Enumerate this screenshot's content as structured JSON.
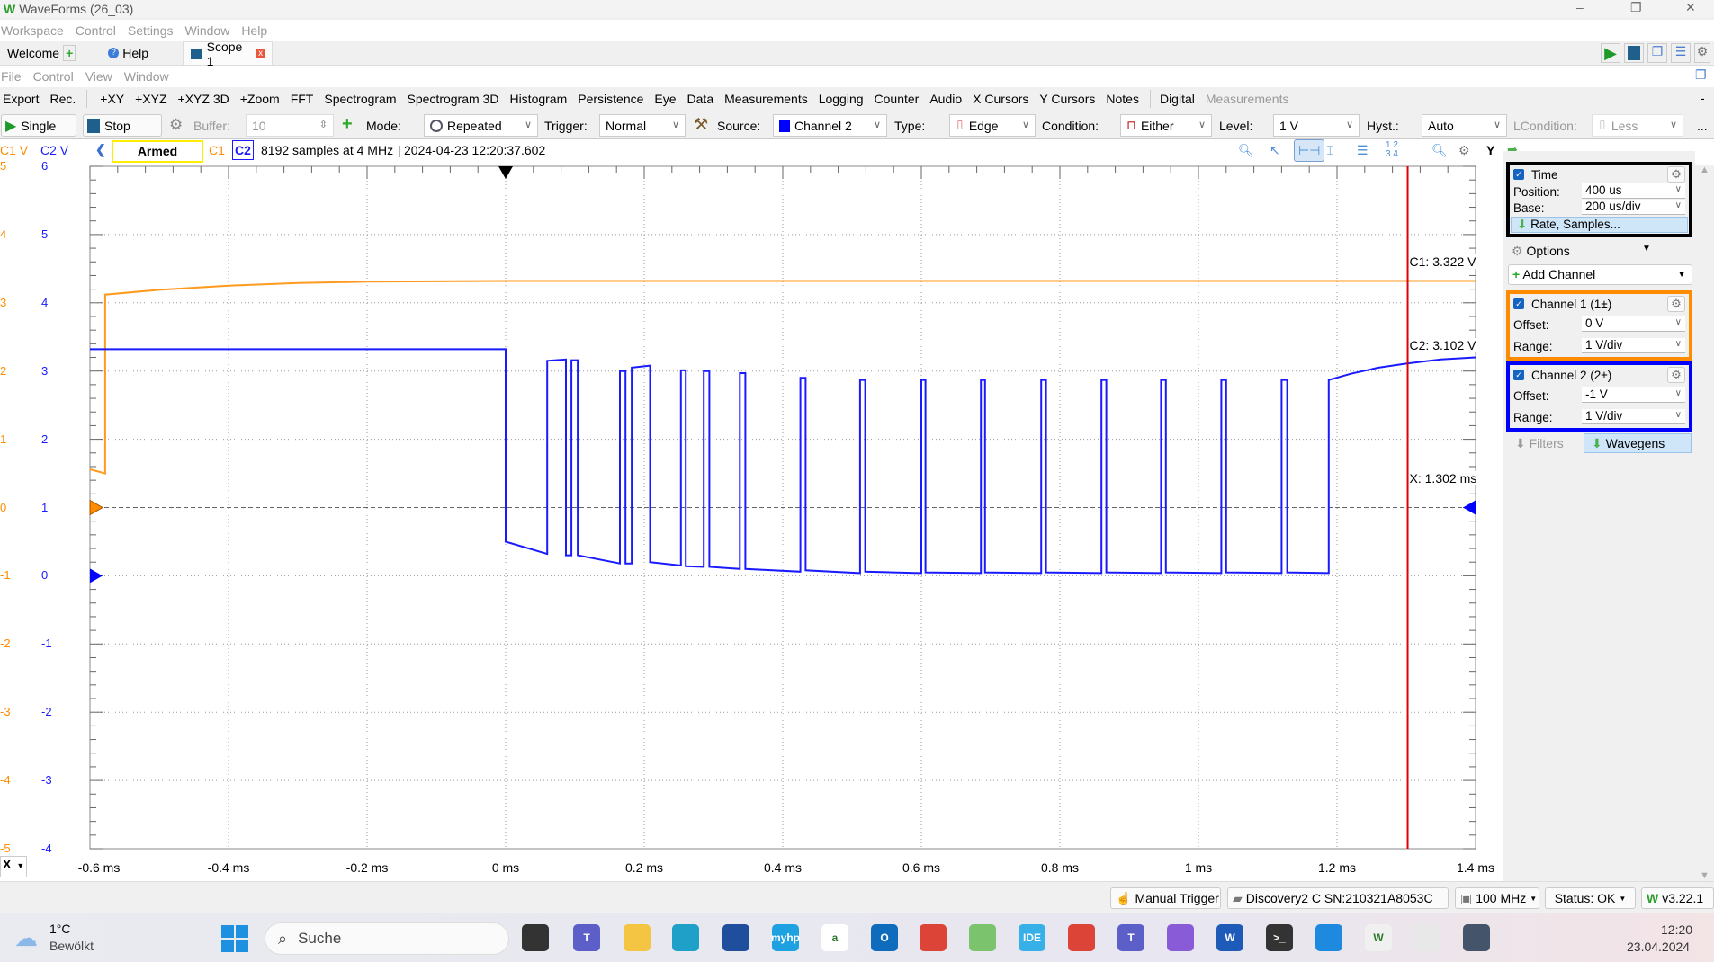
{
  "window": {
    "title": "WaveForms (26_03)",
    "controls": [
      "–",
      "❐",
      "✕"
    ]
  },
  "menu_main": [
    "Workspace",
    "Control",
    "Settings",
    "Window",
    "Help"
  ],
  "tabs": [
    {
      "label": "Welcome",
      "icon": "plus-icon"
    },
    {
      "label": "Help",
      "icon": "help-icon"
    },
    {
      "label": "Scope 1",
      "icon": "scope-icon",
      "active": true,
      "close_icon": "close-icon"
    }
  ],
  "menu_scope": [
    "File",
    "Control",
    "View",
    "Window"
  ],
  "toolbar1": {
    "left": [
      "Export",
      "Rec."
    ],
    "items": [
      "+XY",
      "+XYZ",
      "+XYZ 3D",
      "+Zoom",
      "FFT",
      "Spectrogram",
      "Spectrogram 3D",
      "Histogram",
      "Persistence",
      "Eye",
      "Data",
      "Measurements",
      "Logging",
      "Counter",
      "Audio",
      "X Cursors",
      "Y Cursors",
      "Notes"
    ],
    "digital": "Digital",
    "measurements_disabled": "Measurements",
    "collapse": "-"
  },
  "toolbar2": {
    "single": "Single",
    "stop": "Stop",
    "buffer_label": "Buffer:",
    "buffer_value": "10",
    "mode_label": "Mode:",
    "mode_value": "Repeated",
    "trigger_label": "Trigger:",
    "trigger_value": "Normal",
    "source_label": "Source:",
    "source_value": "Channel 2",
    "type_label": "Type:",
    "type_value": "Edge",
    "condition_label": "Condition:",
    "condition_value": "Either",
    "level_label": "Level:",
    "level_value": "1 V",
    "hyst_label": "Hyst.:",
    "hyst_value": "Auto",
    "lcondition_label": "LCondition:",
    "lcondition_value": "Less",
    "more": "..."
  },
  "info": {
    "c1_unit": "C1 V",
    "c2_unit": "C2 V",
    "state": "Armed",
    "c1": "C1",
    "c2": "C2",
    "acquisition": "8192 samples at 4 MHz",
    "timestamp": "2024-04-23 12:20:37.602",
    "y_label": "Y"
  },
  "colors": {
    "c1": "#ff9a1f",
    "c2": "#1a1aff",
    "cursor": "#e00000",
    "armed_border": "#ffee00"
  },
  "chart_data": {
    "type": "line",
    "x_unit": "ms",
    "xlim": [
      -0.6,
      1.4
    ],
    "x_ticks": [
      "-0.6 ms",
      "-0.4 ms",
      "-0.2 ms",
      "0 ms",
      "0.2 ms",
      "0.4 ms",
      "0.6 ms",
      "0.8 ms",
      "1 ms",
      "1.2 ms",
      "1.4 ms"
    ],
    "c1_ticks": [
      "5",
      "4",
      "3",
      "2",
      "1",
      "0",
      "-1",
      "-2",
      "-3",
      "-4",
      "-5"
    ],
    "c2_ticks": [
      "6",
      "5",
      "4",
      "3",
      "2",
      "1",
      "0",
      "-1",
      "-2",
      "-3",
      "-4"
    ],
    "c1_ylim": [
      -5,
      5
    ],
    "c2_ylim": [
      -4,
      6
    ],
    "grid": true,
    "series": [
      {
        "name": "C1",
        "axis": "c1",
        "points": [
          [
            -0.6,
            0.56
          ],
          [
            -0.578,
            0.5
          ],
          [
            -0.578,
            3.12
          ],
          [
            -0.5,
            3.19
          ],
          [
            -0.4,
            3.25
          ],
          [
            -0.3,
            3.29
          ],
          [
            -0.2,
            3.31
          ],
          [
            0,
            3.32
          ],
          [
            1.4,
            3.32
          ]
        ]
      },
      {
        "name": "C2",
        "axis": "c2",
        "points": [
          [
            -0.6,
            3.32
          ],
          [
            0,
            3.32
          ],
          [
            0,
            0.5
          ],
          [
            0.06,
            0.32
          ],
          [
            0.06,
            3.15
          ],
          [
            0.087,
            3.17
          ],
          [
            0.087,
            0.3
          ],
          [
            0.095,
            0.3
          ],
          [
            0.095,
            3.16
          ],
          [
            0.104,
            3.16
          ],
          [
            0.104,
            0.3
          ],
          [
            0.165,
            0.18
          ],
          [
            0.165,
            3.0
          ],
          [
            0.173,
            3.0
          ],
          [
            0.173,
            0.18
          ],
          [
            0.182,
            0.18
          ],
          [
            0.182,
            3.05
          ],
          [
            0.2085,
            3.08
          ],
          [
            0.2085,
            0.2
          ],
          [
            0.253,
            0.15
          ],
          [
            0.253,
            3.01
          ],
          [
            0.26,
            3.01
          ],
          [
            0.26,
            0.14
          ],
          [
            0.286,
            0.13
          ],
          [
            0.286,
            3.0
          ],
          [
            0.294,
            3.0
          ],
          [
            0.294,
            0.13
          ],
          [
            0.338,
            0.1
          ],
          [
            0.338,
            2.97
          ],
          [
            0.346,
            2.97
          ],
          [
            0.346,
            0.1
          ],
          [
            0.4255,
            0.06
          ],
          [
            0.4255,
            2.9
          ],
          [
            0.433,
            2.9
          ],
          [
            0.433,
            0.08
          ],
          [
            0.5115,
            0.04
          ],
          [
            0.5115,
            2.87
          ],
          [
            0.519,
            2.87
          ],
          [
            0.519,
            0.06
          ],
          [
            0.6,
            0.04
          ],
          [
            0.6,
            2.87
          ],
          [
            0.606,
            2.87
          ],
          [
            0.606,
            0.05
          ],
          [
            0.686,
            0.04
          ],
          [
            0.686,
            2.87
          ],
          [
            0.692,
            2.87
          ],
          [
            0.692,
            0.05
          ],
          [
            0.773,
            0.04
          ],
          [
            0.773,
            2.87
          ],
          [
            0.78,
            2.87
          ],
          [
            0.78,
            0.05
          ],
          [
            0.86,
            0.04
          ],
          [
            0.86,
            2.87
          ],
          [
            0.867,
            2.87
          ],
          [
            0.867,
            0.05
          ],
          [
            0.946,
            0.04
          ],
          [
            0.946,
            2.87
          ],
          [
            0.953,
            2.87
          ],
          [
            0.953,
            0.05
          ],
          [
            1.033,
            0.04
          ],
          [
            1.033,
            2.87
          ],
          [
            1.04,
            2.87
          ],
          [
            1.04,
            0.05
          ],
          [
            1.12,
            0.04
          ],
          [
            1.12,
            2.87
          ],
          [
            1.128,
            2.87
          ],
          [
            1.128,
            0.05
          ],
          [
            1.188,
            0.04
          ],
          [
            1.188,
            2.87
          ],
          [
            1.22,
            2.96
          ],
          [
            1.26,
            3.05
          ],
          [
            1.3,
            3.11
          ],
          [
            1.35,
            3.17
          ],
          [
            1.4,
            3.2
          ]
        ]
      }
    ],
    "trigger_time_ms": 0,
    "trigger_level_c2": 1,
    "cursor": {
      "x_ms": 1.302,
      "x_label": "X: 1.302 ms",
      "c1_label": "C1: 3.322 V",
      "c2_label": "C2: 3.102 V"
    }
  },
  "x_selector": "X",
  "panel": {
    "time": {
      "title": "Time",
      "position_label": "Position:",
      "position_value": "400 us",
      "base_label": "Base:",
      "base_value": "200 us/div",
      "rate_button": "Rate, Samples..."
    },
    "options": "Options",
    "add_channel": "Add Channel",
    "channel1": {
      "title": "Channel 1 (1±)",
      "offset_label": "Offset:",
      "offset_value": "0 V",
      "range_label": "Range:",
      "range_value": "1 V/div"
    },
    "channel2": {
      "title": "Channel 2 (2±)",
      "offset_label": "Offset:",
      "offset_value": "-1 V",
      "range_label": "Range:",
      "range_value": "1 V/div"
    },
    "filters": "Filters",
    "wavegens": "Wavegens"
  },
  "statusbar": {
    "manual_trigger": "Manual Trigger",
    "device": "Discovery2 C SN:210321A8053C",
    "clock": "100 MHz",
    "status": "Status: OK",
    "version": "v3.22.1"
  },
  "taskbar": {
    "weather_temp": "1°C",
    "weather_desc": "Bewölkt",
    "search_placeholder": "Suche",
    "apps": [
      {
        "icon": "task-view-icon",
        "color": "#333",
        "text": ""
      },
      {
        "icon": "teams-icon",
        "color": "#5b5fc7",
        "text": "T"
      },
      {
        "icon": "file-explorer-icon",
        "color": "#f4c542",
        "text": ""
      },
      {
        "icon": "edge-icon",
        "color": "#1fa0c8",
        "text": ""
      },
      {
        "icon": "ms-store-icon",
        "color": "#1f4e9c",
        "text": ""
      },
      {
        "icon": "myhp-icon",
        "color": "#1da1e0",
        "text": "myhp"
      },
      {
        "icon": "amazon-icon",
        "color": "#fff",
        "text": "a"
      },
      {
        "icon": "outlook-icon",
        "color": "#0f6cbd",
        "text": "O"
      },
      {
        "icon": "chrome-icon",
        "color": "#db4437",
        "text": ""
      },
      {
        "icon": "app-icon",
        "color": "#7cc36e",
        "text": ""
      },
      {
        "icon": "ide-icon",
        "color": "#36b0e6",
        "text": "IDE"
      },
      {
        "icon": "chrome-icon",
        "color": "#db4437",
        "text": ""
      },
      {
        "icon": "teams-new-icon",
        "color": "#5b5fc7",
        "text": "T"
      },
      {
        "icon": "visual-studio-icon",
        "color": "#8a5bd6",
        "text": ""
      },
      {
        "icon": "word-icon",
        "color": "#1e5bb8",
        "text": "W"
      },
      {
        "icon": "terminal-icon",
        "color": "#333",
        "text": ">_"
      },
      {
        "icon": "vscode-icon",
        "color": "#1d8ae0",
        "text": ""
      },
      {
        "icon": "waveforms-icon",
        "color": "#f0f0f0",
        "text": "W"
      },
      {
        "icon": "snipping-tool-icon",
        "color": "#e8e8e8",
        "text": ""
      },
      {
        "icon": "calculator-icon",
        "color": "#44546a",
        "text": ""
      }
    ],
    "time": "12:20",
    "date": "23.04.2024"
  }
}
